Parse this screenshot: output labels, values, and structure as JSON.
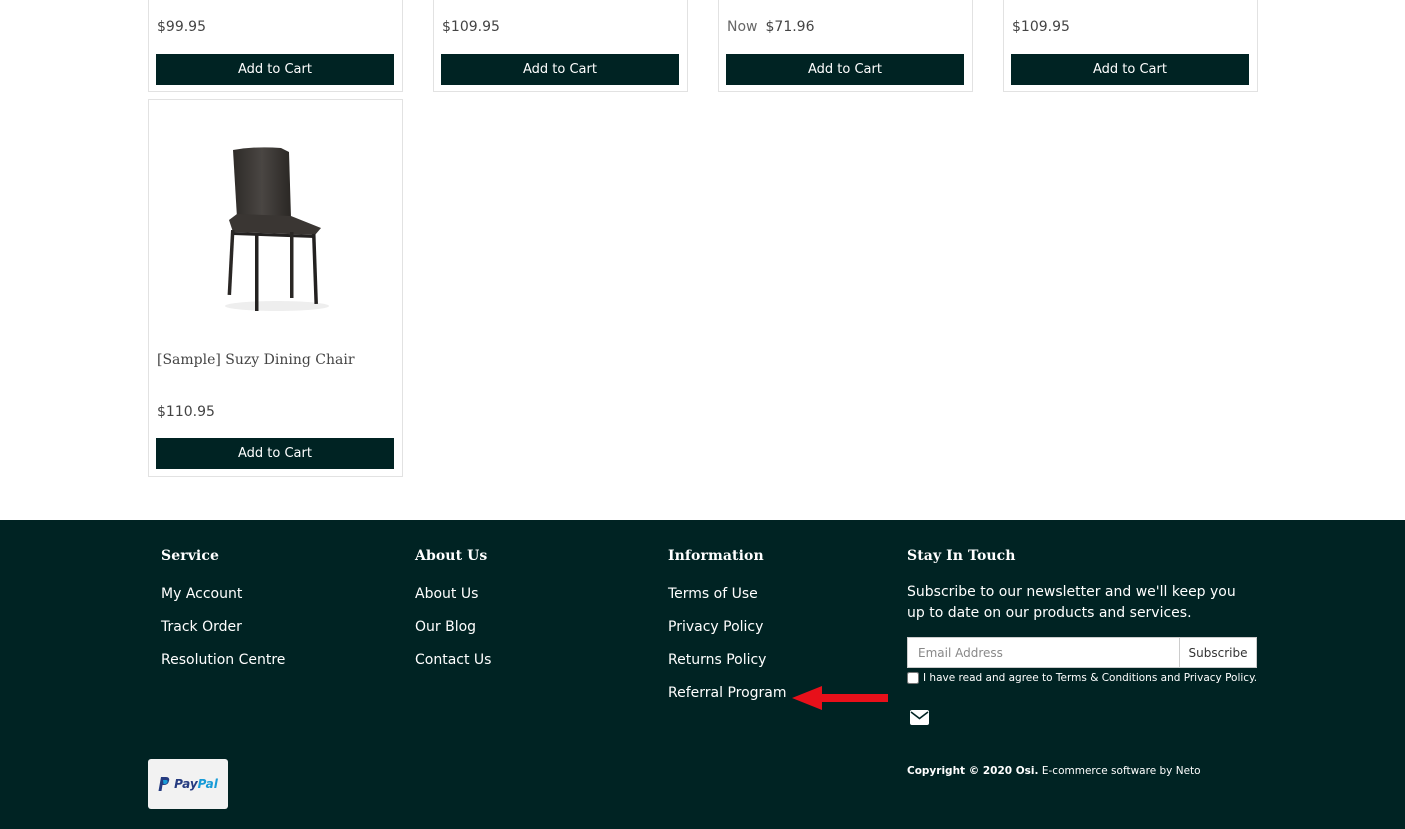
{
  "products_top": [
    {
      "price": "$99.95",
      "button": "Add to Cart"
    },
    {
      "price": "$109.95",
      "button": "Add to Cart"
    },
    {
      "price_prefix": "Now",
      "price": "$71.96",
      "button": "Add to Cart"
    },
    {
      "price": "$109.95",
      "button": "Add to Cart"
    }
  ],
  "product_featured": {
    "name": "[Sample] Suzy Dining Chair",
    "price": "$110.95",
    "button": "Add to Cart"
  },
  "footer": {
    "service": {
      "heading": "Service",
      "links": [
        "My Account",
        "Track Order",
        "Resolution Centre"
      ]
    },
    "about": {
      "heading": "About Us",
      "links": [
        "About Us",
        "Our Blog",
        "Contact Us"
      ]
    },
    "information": {
      "heading": "Information",
      "links": [
        "Terms of Use",
        "Privacy Policy",
        "Returns Policy",
        "Referral Program"
      ]
    },
    "newsletter": {
      "heading": "Stay In Touch",
      "text": "Subscribe to our newsletter and we'll keep you up to date on our products and services.",
      "placeholder": "Email Address",
      "button": "Subscribe",
      "agree_text": "I have read and agree to Terms & Conditions and Privacy Policy."
    },
    "payment": {
      "brand_a": "Pay",
      "brand_b": "Pal"
    },
    "copyright_bold": "Copyright © 2020 Osi.",
    "copyright_rest": " E-commerce software by Neto"
  },
  "colors": {
    "brand_dark": "#002323",
    "annotation_arrow": "#e8101a"
  }
}
